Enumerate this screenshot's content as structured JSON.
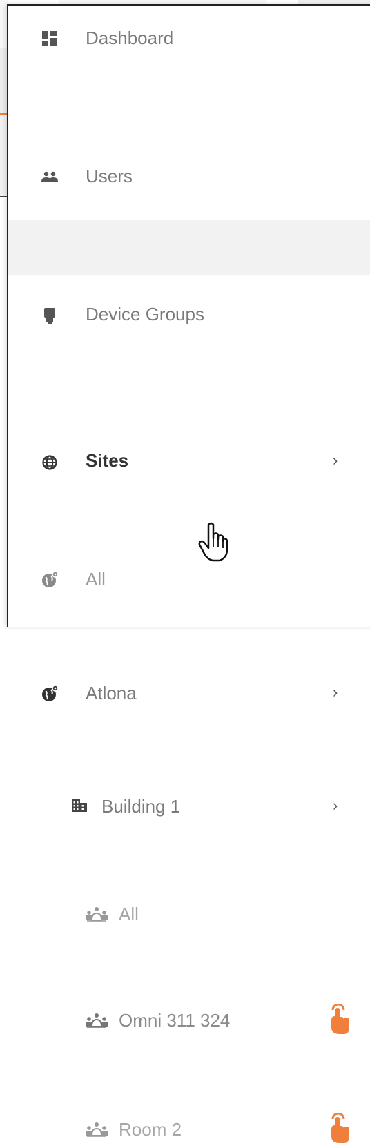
{
  "menu": {
    "dashboard": "Dashboard",
    "users": "Users",
    "device_groups": "Device Groups",
    "sites": "Sites",
    "sites_all": "All",
    "atlona": "Atlona",
    "building": "Building 1",
    "rooms_all": "All",
    "room_omni": "Omni 311 324",
    "room_2": "Room 2",
    "chevron": "›"
  },
  "icons": {
    "dashboard": "dashboard-icon",
    "users": "users-icon",
    "device_groups": "device-group-icon",
    "sites": "globe-icon",
    "site": "globe-pin-icon",
    "building": "building-icon",
    "room": "room-people-icon",
    "touch": "touch-hand-icon"
  },
  "colors": {
    "accent": "#f07f3c",
    "active_bg": "#f2f2f2"
  }
}
